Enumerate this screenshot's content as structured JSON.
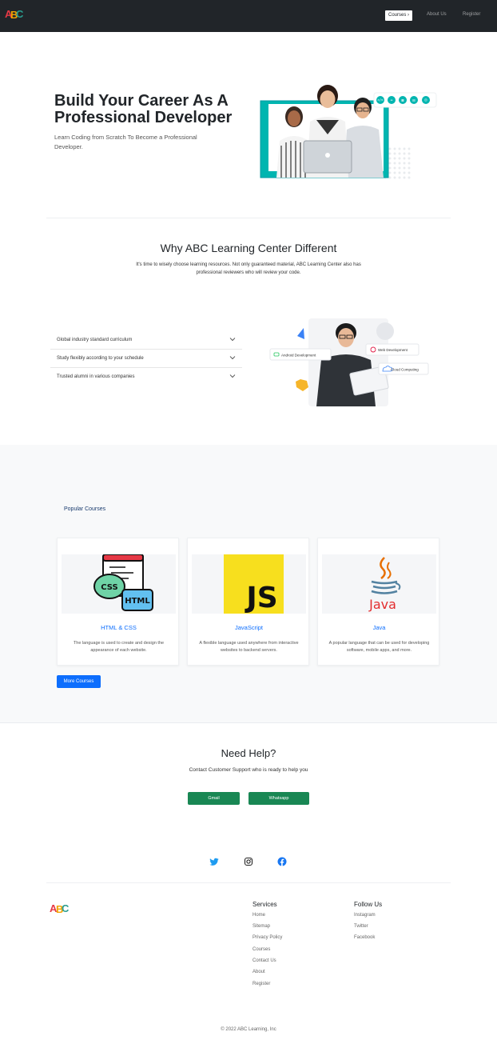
{
  "nav": {
    "logo_letters": [
      "A",
      "B",
      "C"
    ],
    "logo_colors": [
      "#e63946",
      "#f4a300",
      "#2a9d8f"
    ],
    "courses_label": "Courses",
    "courses_arrow": "›",
    "about_label": "About Us",
    "register_label": "Register"
  },
  "hero": {
    "title": "Build Your Career As A Professional Developer",
    "subtitle": "Learn Coding from Scratch To Become a Professional Developer.",
    "badge_icons": [
      "code-icon",
      "list-icon",
      "grid-icon",
      "chart-icon",
      "bot-icon"
    ],
    "accent_color": "#00b5b0"
  },
  "why": {
    "title": "Why ABC Learning Center Different",
    "subtitle": "It's time to wisely choose learning resources. Not only guaranteed material, ABC Learning Center also has professional reviewers who will review your code.",
    "items": [
      "Global industry standard curriculum",
      "Study flexibly according to your schedule",
      "Trusted alumni in various companies"
    ],
    "tags": {
      "android": "Android Development",
      "web": "Web Development",
      "cloud": "Cloud Computing"
    }
  },
  "courses": {
    "label": "Popular Courses",
    "cards": [
      {
        "title": "HTML & CSS",
        "desc": "The language is used to create and design the appearance of each website.",
        "icon": "html-css-icon"
      },
      {
        "title": "JavaScript",
        "desc": "A flexible language used anywhere from interactive websites to backend servers.",
        "icon": "javascript-icon"
      },
      {
        "title": "Java",
        "desc": "A popular language that can be used for developing software, mobile apps, and more.",
        "icon": "java-icon"
      }
    ],
    "more_label": "More Courses",
    "html_label": "HTML",
    "css_label": "CSS",
    "js_label": "JS",
    "java_label": "Java"
  },
  "help": {
    "title": "Need Help?",
    "subtitle": "Contact Customer Support who is ready to help you",
    "gmail_label": "Gmail",
    "whatsapp_label": "Whatsapp"
  },
  "social": [
    "twitter-icon",
    "instagram-icon",
    "facebook-icon"
  ],
  "footer": {
    "services_title": "Services",
    "services": [
      "Home",
      "Sitemap",
      "Privacy Policy",
      "Courses",
      "Contact Us",
      "About",
      "Register"
    ],
    "follow_title": "Follow Us",
    "follow": [
      "Instagram",
      "Twitter",
      "Facebook"
    ],
    "copyright": "© 2022 ABC Learning, Inc"
  }
}
